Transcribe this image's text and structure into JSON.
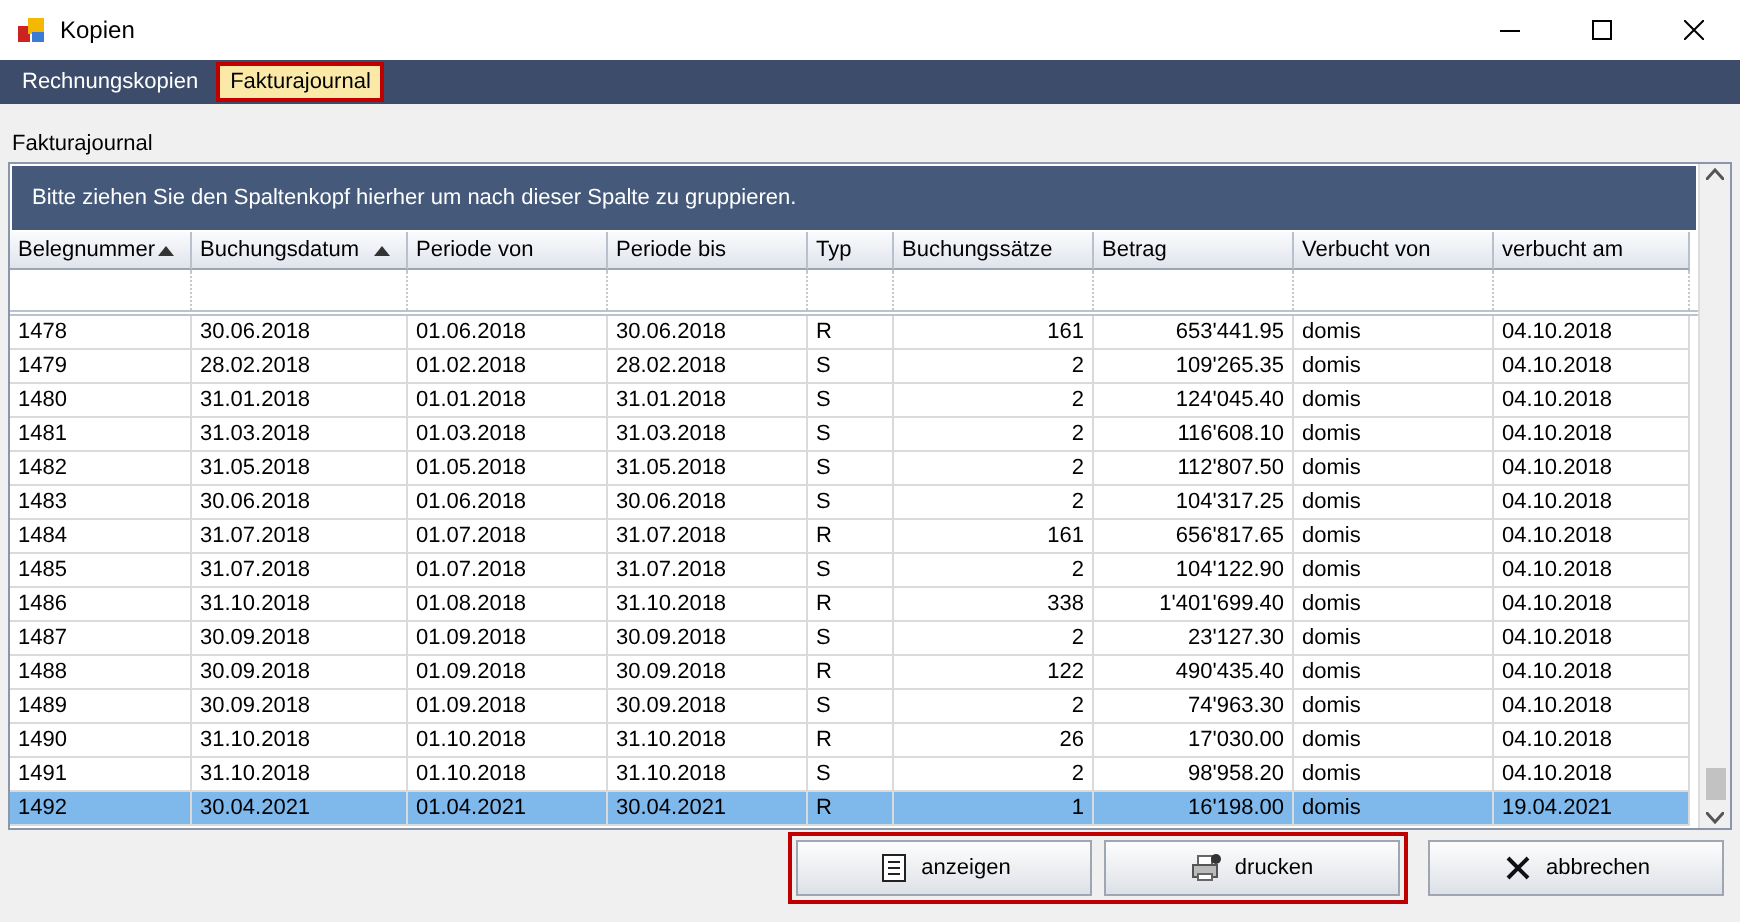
{
  "window": {
    "title": "Kopien"
  },
  "menu": [
    {
      "label": "Rechnungskopien",
      "selected": false,
      "highlighted": false
    },
    {
      "label": "Fakturajournal",
      "selected": true,
      "highlighted": true
    }
  ],
  "section_label": "Fakturajournal",
  "group_panel": "Bitte ziehen Sie den Spaltenkopf hierher um nach dieser Spalte zu gruppieren.",
  "table": {
    "columns": [
      {
        "label": "Belegnummer",
        "sorted": true
      },
      {
        "label": "Buchungsdatum",
        "sorted": true
      },
      {
        "label": "Periode von",
        "sorted": false
      },
      {
        "label": "Periode bis",
        "sorted": false
      },
      {
        "label": "Typ",
        "sorted": false
      },
      {
        "label": "Buchungssätze",
        "sorted": false
      },
      {
        "label": "Betrag",
        "sorted": false
      },
      {
        "label": "Verbucht von",
        "sorted": false
      },
      {
        "label": "verbucht am",
        "sorted": false
      }
    ],
    "rows": [
      {
        "selected": false,
        "cells": [
          "1478",
          "30.06.2018",
          "01.06.2018",
          "30.06.2018",
          "R",
          "161",
          "653'441.95",
          "domis",
          "04.10.2018"
        ]
      },
      {
        "selected": false,
        "cells": [
          "1479",
          "28.02.2018",
          "01.02.2018",
          "28.02.2018",
          "S",
          "2",
          "109'265.35",
          "domis",
          "04.10.2018"
        ]
      },
      {
        "selected": false,
        "cells": [
          "1480",
          "31.01.2018",
          "01.01.2018",
          "31.01.2018",
          "S",
          "2",
          "124'045.40",
          "domis",
          "04.10.2018"
        ]
      },
      {
        "selected": false,
        "cells": [
          "1481",
          "31.03.2018",
          "01.03.2018",
          "31.03.2018",
          "S",
          "2",
          "116'608.10",
          "domis",
          "04.10.2018"
        ]
      },
      {
        "selected": false,
        "cells": [
          "1482",
          "31.05.2018",
          "01.05.2018",
          "31.05.2018",
          "S",
          "2",
          "112'807.50",
          "domis",
          "04.10.2018"
        ]
      },
      {
        "selected": false,
        "cells": [
          "1483",
          "30.06.2018",
          "01.06.2018",
          "30.06.2018",
          "S",
          "2",
          "104'317.25",
          "domis",
          "04.10.2018"
        ]
      },
      {
        "selected": false,
        "cells": [
          "1484",
          "31.07.2018",
          "01.07.2018",
          "31.07.2018",
          "R",
          "161",
          "656'817.65",
          "domis",
          "04.10.2018"
        ]
      },
      {
        "selected": false,
        "cells": [
          "1485",
          "31.07.2018",
          "01.07.2018",
          "31.07.2018",
          "S",
          "2",
          "104'122.90",
          "domis",
          "04.10.2018"
        ]
      },
      {
        "selected": false,
        "cells": [
          "1486",
          "31.10.2018",
          "01.08.2018",
          "31.10.2018",
          "R",
          "338",
          "1'401'699.40",
          "domis",
          "04.10.2018"
        ]
      },
      {
        "selected": false,
        "cells": [
          "1487",
          "30.09.2018",
          "01.09.2018",
          "30.09.2018",
          "S",
          "2",
          "23'127.30",
          "domis",
          "04.10.2018"
        ]
      },
      {
        "selected": false,
        "cells": [
          "1488",
          "30.09.2018",
          "01.09.2018",
          "30.09.2018",
          "R",
          "122",
          "490'435.40",
          "domis",
          "04.10.2018"
        ]
      },
      {
        "selected": false,
        "cells": [
          "1489",
          "30.09.2018",
          "01.09.2018",
          "30.09.2018",
          "S",
          "2",
          "74'963.30",
          "domis",
          "04.10.2018"
        ]
      },
      {
        "selected": false,
        "cells": [
          "1490",
          "31.10.2018",
          "01.10.2018",
          "31.10.2018",
          "R",
          "26",
          "17'030.00",
          "domis",
          "04.10.2018"
        ]
      },
      {
        "selected": false,
        "cells": [
          "1491",
          "31.10.2018",
          "01.10.2018",
          "31.10.2018",
          "S",
          "2",
          "98'958.20",
          "domis",
          "04.10.2018"
        ]
      },
      {
        "selected": true,
        "cells": [
          "1492",
          "30.04.2021",
          "01.04.2021",
          "30.04.2021",
          "R",
          "1",
          "16'198.00",
          "domis",
          "19.04.2021"
        ]
      }
    ]
  },
  "buttons": [
    {
      "kind": "view",
      "label": "anzeigen",
      "highlighted": true
    },
    {
      "kind": "print",
      "label": "drucken",
      "highlighted": true
    },
    {
      "kind": "cancel",
      "label": "abbrechen",
      "highlighted": false
    }
  ]
}
